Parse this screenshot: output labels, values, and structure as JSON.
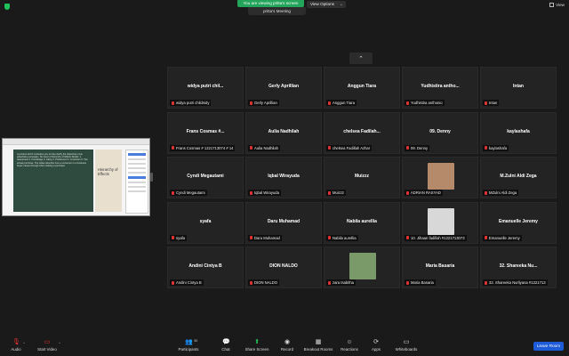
{
  "top": {
    "viewing_banner": "You are viewing pritta's screen",
    "presenter_tab": "pritta's Meeting",
    "view_options": "View Options",
    "view_options_caret": "⌄",
    "view_button": "View"
  },
  "colors": {
    "accent_green": "#22a55a",
    "leave_blue": "#1e5bd6",
    "muted_red": "#dd3333",
    "tile_bg": "#232323"
  },
  "gallery": {
    "up_arrow": "⌃",
    "tiles": [
      {
        "display": "widya  putri  chil...",
        "label": "widya putri childnidy",
        "photo": false
      },
      {
        "display": "Gerly Aprillian",
        "label": "Gerly Aprillian",
        "photo": false
      },
      {
        "display": "Anggun Tiara",
        "label": "Anggun Tiara",
        "photo": false
      },
      {
        "display": "Yudhistira  antho...",
        "label": "Yudhistira anthonio",
        "photo": false
      },
      {
        "display": "Intan",
        "label": "Intan",
        "photo": false
      },
      {
        "display": "Frans Cosmas #...",
        "label": "Frans Cosmas # 1221713074 # 14",
        "photo": false
      },
      {
        "display": "Aulia Nadhilah",
        "label": "Aulia Nadhilah",
        "photo": false
      },
      {
        "display": "chelsea  Fadilah...",
        "label": "chelsea Fadillah Azhar",
        "photo": false
      },
      {
        "display": "09. Denny",
        "label": "09. Denny",
        "photo": false
      },
      {
        "display": "kaylashafa",
        "label": "kaylashafa",
        "photo": false
      },
      {
        "display": "Cyndi Megautami",
        "label": "Cyndi Megautami",
        "photo": false
      },
      {
        "display": "Iqbal Wirayuda",
        "label": "Iqbal Wirayuda",
        "photo": false
      },
      {
        "display": "Muizzz",
        "label": "Muizzz",
        "photo": false
      },
      {
        "display": "",
        "label": "ADRIAN RASYAD",
        "photo": true,
        "photo_color": "#b48a6a"
      },
      {
        "display": "M.Zulni Aldi Zega",
        "label": "MZulni Aldi Zega",
        "photo": false
      },
      {
        "display": "syafa",
        "label": "syafa",
        "photo": false
      },
      {
        "display": "Daru Muhamad",
        "label": "Daru Muhamad",
        "photo": false
      },
      {
        "display": "Nabila aurellia",
        "label": "Nabila aurellia",
        "photo": false
      },
      {
        "display": "",
        "label": "10. Jihaan fadillah #1221713073",
        "photo": true,
        "photo_color": "#d8d8d8"
      },
      {
        "display": "Emanuelle Jeremy",
        "label": "Emanuelle Jeremy",
        "photo": false
      },
      {
        "display": "Andini Cintya B",
        "label": "Andini Cintya B",
        "photo": false
      },
      {
        "display": "DION NALDO",
        "label": "DION NALDO",
        "photo": false
      },
      {
        "display": "",
        "label": "zara tsabitha",
        "photo": true,
        "photo_color": "#7a9a6a"
      },
      {
        "display": "Maria Basaria",
        "label": "Maria Basaria",
        "photo": false
      },
      {
        "display": "32.  Shareeka  Nu...",
        "label": "32. Shareeka Nurliyana #1221713",
        "photo": false
      }
    ]
  },
  "shared_screen": {
    "slide_text": "A product which motivates you to help clarify the objectives of an advertising campaign. Six level of hierarchy of Effects Model: 1. Awareness 2. Knowledge 3. Liking 4. Preference 5. Conviction 6. The actual purchase. The slides describe how a consumer or a business buyer moves through when making a purchase",
    "side_title": "Hierarchy of Effects"
  },
  "toolbar": {
    "audio": "Audio",
    "start_video": "Start Video",
    "participants": "Participants",
    "participants_count": "30",
    "chat": "Chat",
    "share_screen": "Share Screen",
    "record": "Record",
    "breakout_rooms": "Breakout Rooms",
    "reactions": "Reactions",
    "apps": "Apps",
    "whiteboards": "Whiteboards",
    "leave": "Leave Room",
    "caret": "^"
  }
}
